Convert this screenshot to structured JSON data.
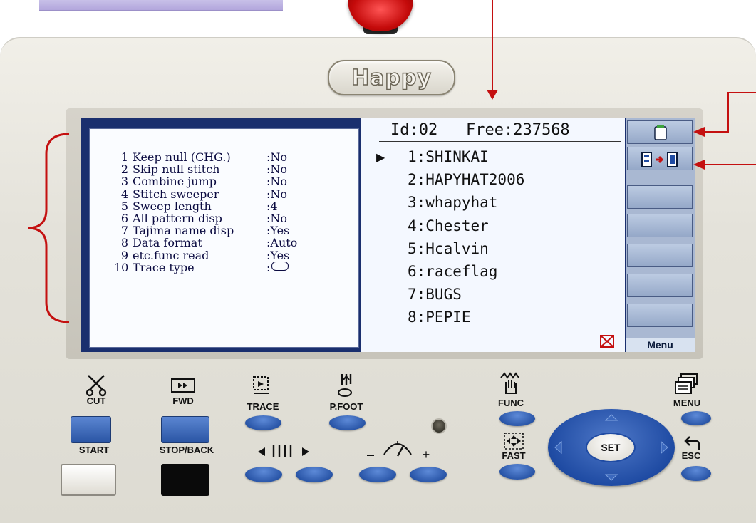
{
  "logo": {
    "text": "Happy"
  },
  "settings": [
    {
      "num": "1",
      "label": "Keep null (CHG.)",
      "value": ":No"
    },
    {
      "num": "2",
      "label": "Skip null stitch",
      "value": ":No"
    },
    {
      "num": "3",
      "label": "Combine jump",
      "value": ":No"
    },
    {
      "num": "4",
      "label": "Stitch sweeper",
      "value": ":No"
    },
    {
      "num": "5",
      "label": "Sweep length",
      "value": ":4"
    },
    {
      "num": "6",
      "label": "All pattern disp",
      "value": ":No"
    },
    {
      "num": "7",
      "label": "Tajima name disp",
      "value": ":Yes"
    },
    {
      "num": "8",
      "label": "Data format",
      "value": ":Auto"
    },
    {
      "num": "9",
      "label": "etc.func read",
      "value": ":Yes"
    },
    {
      "num": "10",
      "label": "Trace type",
      "value": ":"
    }
  ],
  "list_header": {
    "id": "Id:02",
    "free": "Free:237568"
  },
  "patterns": [
    "1:SHINKAI",
    "2:HAPYHAT2006",
    "3:whapyhat",
    "4:Chester",
    "5:Hcalvin",
    "6:raceflag",
    "7:BUGS",
    "8:PEPIE"
  ],
  "side_menu": {
    "label": "Menu"
  },
  "buttons": {
    "cut": "CUT",
    "fwd": "FWD",
    "trace": "TRACE",
    "pfoot": "P.FOOT",
    "func": "FUNC",
    "menu": "MENU",
    "start": "START",
    "stop_back": "STOP/BACK",
    "fast": "FAST",
    "esc": "ESC",
    "set": "SET",
    "minus": "–",
    "plus": "+"
  },
  "icons": [
    "scissors-icon",
    "fast-forward-icon",
    "trace-icon",
    "presser-foot-icon",
    "function-hand-icon",
    "menu-icon",
    "needle-select-icon",
    "speed-gauge-icon",
    "fast-arrows-icon",
    "escape-return-icon",
    "memory-card-icon",
    "transfer-icon",
    "no-card-icon"
  ],
  "colors": {
    "key_blue": "#2a56a8",
    "annotation_red": "#c41010",
    "screen_bg": "#f4f8ff"
  }
}
